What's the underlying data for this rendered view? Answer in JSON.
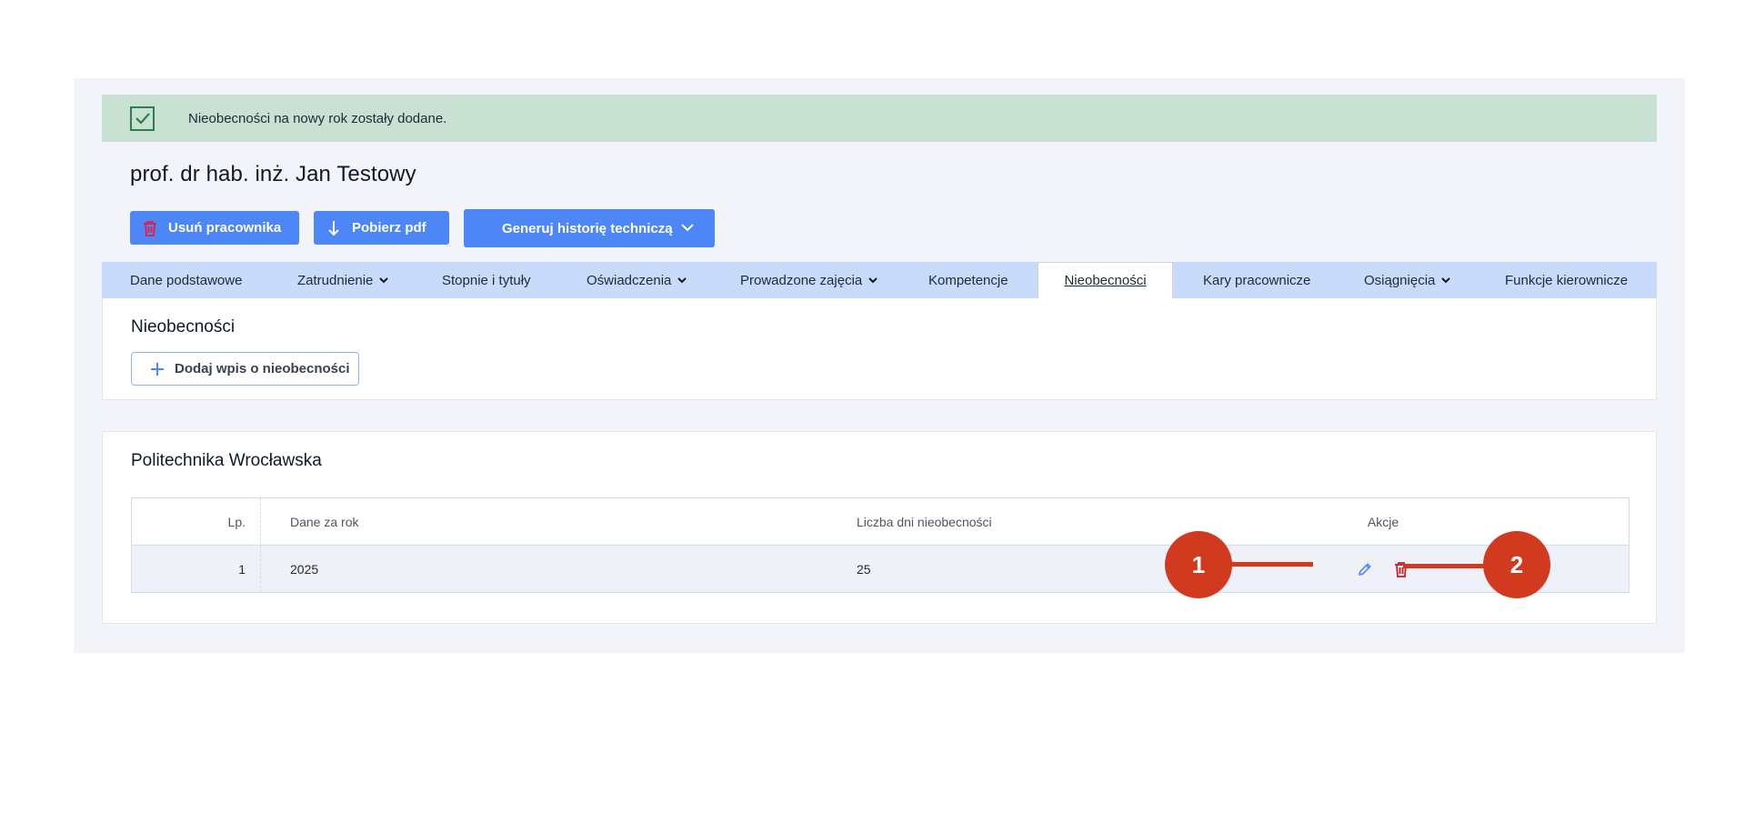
{
  "alert": {
    "message": "Nieobecności na nowy rok zostały dodane."
  },
  "employee": {
    "name": "prof. dr hab. inż. Jan Testowy"
  },
  "actions": {
    "delete_label": "Usuń pracownika",
    "pdf_label": "Pobierz pdf",
    "history_label": "Generuj historię techniczą"
  },
  "tabs": [
    {
      "label": "Dane podstawowe"
    },
    {
      "label": "Zatrudnienie"
    },
    {
      "label": "Stopnie i tytuły"
    },
    {
      "label": "Oświadczenia"
    },
    {
      "label": "Prowadzone zajęcia"
    },
    {
      "label": "Kompetencje"
    },
    {
      "label": "Nieobecności"
    },
    {
      "label": "Kary pracownicze"
    },
    {
      "label": "Osiągnięcia"
    },
    {
      "label": "Funkcje kierownicze"
    }
  ],
  "absences": {
    "title": "Nieobecności",
    "add_label": "Dodaj wpis o nieobecności"
  },
  "org": {
    "title": "Politechnika Wrocławska",
    "columns": [
      "Lp.",
      "Dane za rok",
      "Liczba dni nieobecności",
      "Akcje"
    ],
    "rows": [
      {
        "lp": "1",
        "year": "2025",
        "days": "25"
      }
    ]
  },
  "callouts": [
    "1",
    "2"
  ],
  "colors": {
    "primary": "#4c86f7",
    "alert_bg": "#c8e1d3",
    "tabs_bg": "#c9dbfa",
    "danger": "#c81e1e",
    "callout": "#d13a1e"
  }
}
